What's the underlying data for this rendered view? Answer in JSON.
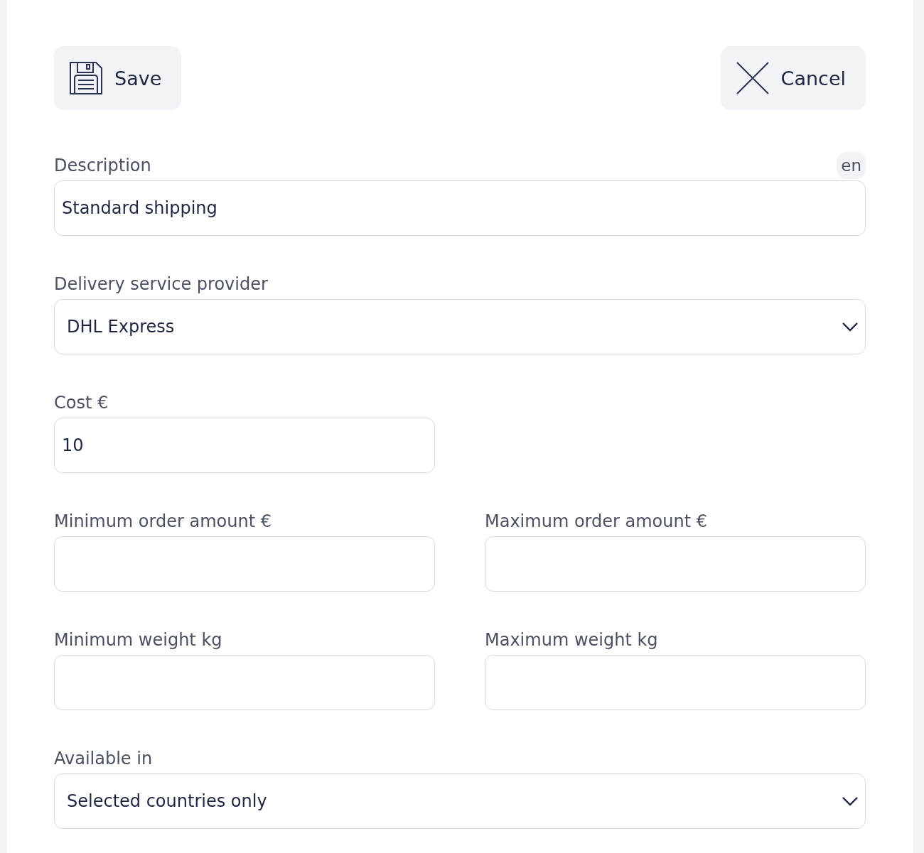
{
  "toolbar": {
    "save": "Save",
    "cancel": "Cancel"
  },
  "rows": [
    {
      "kind": "full",
      "fields": [
        {
          "label": "Description",
          "kind": "text",
          "value": "Standard shipping",
          "language": "en"
        }
      ]
    },
    {
      "kind": "full",
      "fields": [
        {
          "label": "Delivery service provider",
          "kind": "select",
          "value": "DHL Express"
        }
      ]
    },
    {
      "kind": "columns",
      "fields": [
        {
          "label": "Cost €",
          "kind": "text",
          "value": "10"
        }
      ]
    },
    {
      "kind": "columns",
      "fields": [
        {
          "label": "Minimum order amount €",
          "kind": "text"
        },
        {
          "label": "Maximum order amount €",
          "kind": "text"
        }
      ]
    },
    {
      "kind": "columns",
      "fields": [
        {
          "label": "Minimum weight kg",
          "kind": "text"
        },
        {
          "label": "Maximum weight kg",
          "kind": "text"
        }
      ]
    },
    {
      "kind": "full",
      "fields": [
        {
          "label": "Available in",
          "kind": "select",
          "value": "Selected countries only"
        }
      ]
    }
  ]
}
